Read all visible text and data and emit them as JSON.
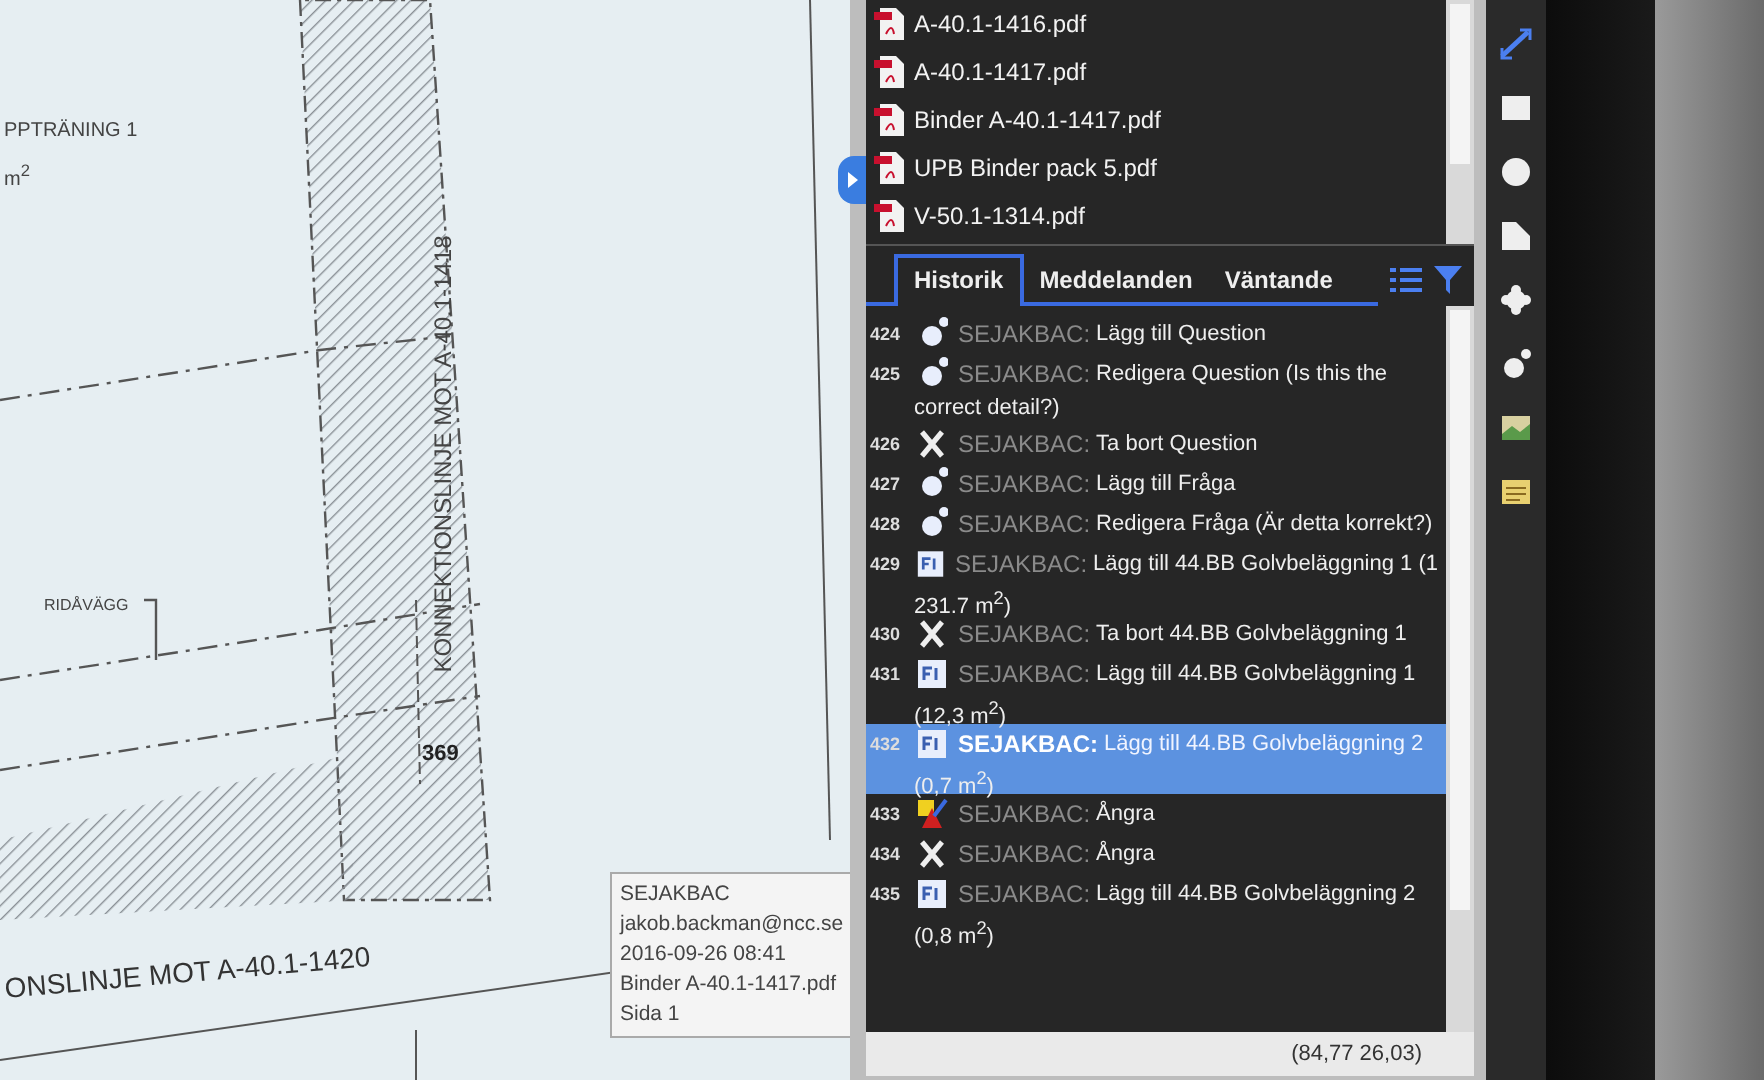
{
  "drawing": {
    "room_name": "PPTRÄNING 1",
    "room_area": "m$^{2}$",
    "wall_label": "RIDÅVÄGG",
    "dimension": "369",
    "connection_line_vertical": "KONNEKTIONSLINJE MOT A-40.1-1418",
    "connection_line_horizontal": "ONSLINJE MOT A-40.1-1420"
  },
  "tooltip": {
    "lines": [
      "SEJAKBAC",
      "jakob.backman@ncc.se",
      "2016-09-26 08:41",
      "Binder A-40.1-1417.pdf",
      "Sida 1"
    ]
  },
  "files": [
    {
      "name": "A-40.1-1416.pdf"
    },
    {
      "name": "A-40.1-1417.pdf"
    },
    {
      "name": "Binder A-40.1-1417.pdf"
    },
    {
      "name": "UPB Binder pack 5.pdf"
    },
    {
      "name": "V-50.1-1314.pdf"
    }
  ],
  "tabs": [
    {
      "label": "Historik",
      "selected": true
    },
    {
      "label": "Meddelanden",
      "selected": false
    },
    {
      "label": "Väntande",
      "selected": false
    }
  ],
  "history": [
    {
      "number": "424",
      "kind": "markup",
      "user": "SEJAKBAC:",
      "action": "Lägg till Question",
      "selected": false
    },
    {
      "number": "425",
      "kind": "markup",
      "user": "SEJAKBAC:",
      "action": "Redigera Question (Is this the",
      "continued": "correct detail?)",
      "selected": false
    },
    {
      "number": "426",
      "kind": "delete",
      "user": "SEJAKBAC:",
      "action": "Ta bort Question",
      "selected": false
    },
    {
      "number": "427",
      "kind": "markup",
      "user": "SEJAKBAC:",
      "action": "Lägg till Fråga",
      "selected": false
    },
    {
      "number": "428",
      "kind": "markup",
      "user": "SEJAKBAC:",
      "action": "Redigera Fråga (Är detta korrekt?)",
      "selected": false
    },
    {
      "number": "429",
      "kind": "area",
      "user": "SEJAKBAC:",
      "action": "Lägg till 44.BB Golvbeläggning 1 (1",
      "continued": "231.7 m$^{2}$)",
      "selected": false
    },
    {
      "number": "430",
      "kind": "delete",
      "user": "SEJAKBAC:",
      "action": "Ta bort 44.BB Golvbeläggning 1",
      "selected": false
    },
    {
      "number": "431",
      "kind": "area",
      "user": "SEJAKBAC:",
      "action": "Lägg till 44.BB Golvbeläggning 1",
      "continued": "(12,3 m$^{2}$)",
      "selected": false
    },
    {
      "number": "432",
      "kind": "area",
      "user": "SEJAKBAC:",
      "action": "Lägg till 44.BB Golvbeläggning 2",
      "continued": "(0,7 m$^{2}$)",
      "selected": true
    },
    {
      "number": "433",
      "kind": "undo",
      "user": "SEJAKBAC:",
      "action": "Ångra",
      "selected": false
    },
    {
      "number": "434",
      "kind": "delete",
      "user": "SEJAKBAC:",
      "action": "Ångra",
      "selected": false
    },
    {
      "number": "435",
      "kind": "area",
      "user": "SEJAKBAC:",
      "action": "Lägg till 44.BB Golvbeläggning 2",
      "continued": "(0,8 m$^{2}$)",
      "selected": false
    }
  ],
  "status_bar": {
    "coordinates": "(84,77 26,03)"
  }
}
